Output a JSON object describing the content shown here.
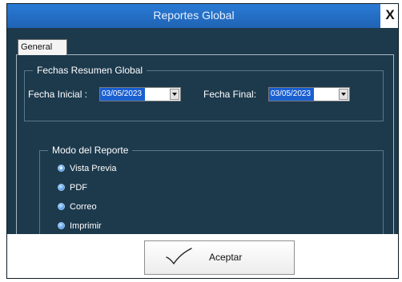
{
  "window": {
    "title": "Reportes Global",
    "close_glyph": "X"
  },
  "tabs": [
    {
      "label": "General"
    }
  ],
  "dates_group": {
    "title": "Fechas Resumen Global",
    "fecha_inicial_label": "Fecha Inicial :",
    "fecha_inicial_value": "03/05/2023",
    "fecha_final_label": "Fecha Final:",
    "fecha_final_value": "03/05/2023"
  },
  "mode_group": {
    "title": "Modo del  Reporte",
    "options": [
      {
        "label": "Vista Previa",
        "checked": true
      },
      {
        "label": "PDF",
        "checked": false
      },
      {
        "label": "Correo",
        "checked": false
      },
      {
        "label": "Imprimir",
        "checked": false
      }
    ]
  },
  "actions": {
    "accept_label": "Aceptar",
    "accept_icon": "checkmark-icon"
  },
  "colors": {
    "window_bg": "#1d3a4d",
    "titlebar": "#2a7bd6",
    "radio": "#66aaf2",
    "date_selection": "#1a5fd0"
  }
}
